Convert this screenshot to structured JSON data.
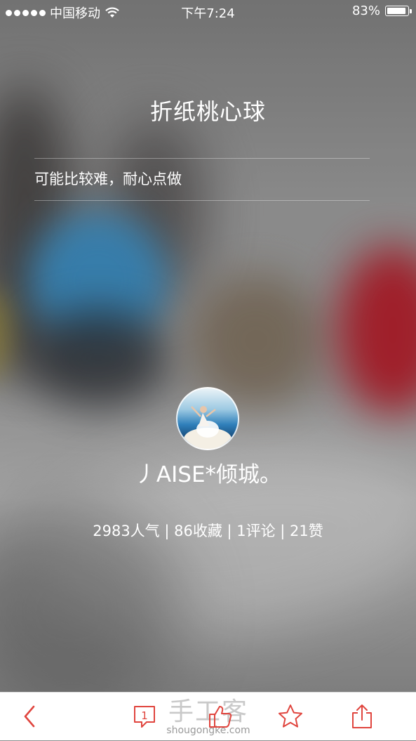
{
  "status_bar": {
    "carrier": "中国移动",
    "time": "下午7:24",
    "battery": "83%"
  },
  "project": {
    "title": "折纸桃心球",
    "description": "可能比较难，耐心点做"
  },
  "author": {
    "name": "丿AISE*倾城。"
  },
  "stats": {
    "text": "2983人气 | 86收藏 | 1评论 | 21赞"
  },
  "toolbar": {
    "back_icon": "chevron-left-icon",
    "comment_icon": "comment-icon",
    "comment_count": "1",
    "like_icon": "thumbs-up-icon",
    "favorite_icon": "star-icon",
    "share_icon": "share-icon"
  },
  "watermark": {
    "cn": "手工客",
    "en": "shougongke.com"
  },
  "colors": {
    "accent": "#e0453e",
    "text_on_image": "#ffffff",
    "toolbar_bg": "#ffffff"
  }
}
